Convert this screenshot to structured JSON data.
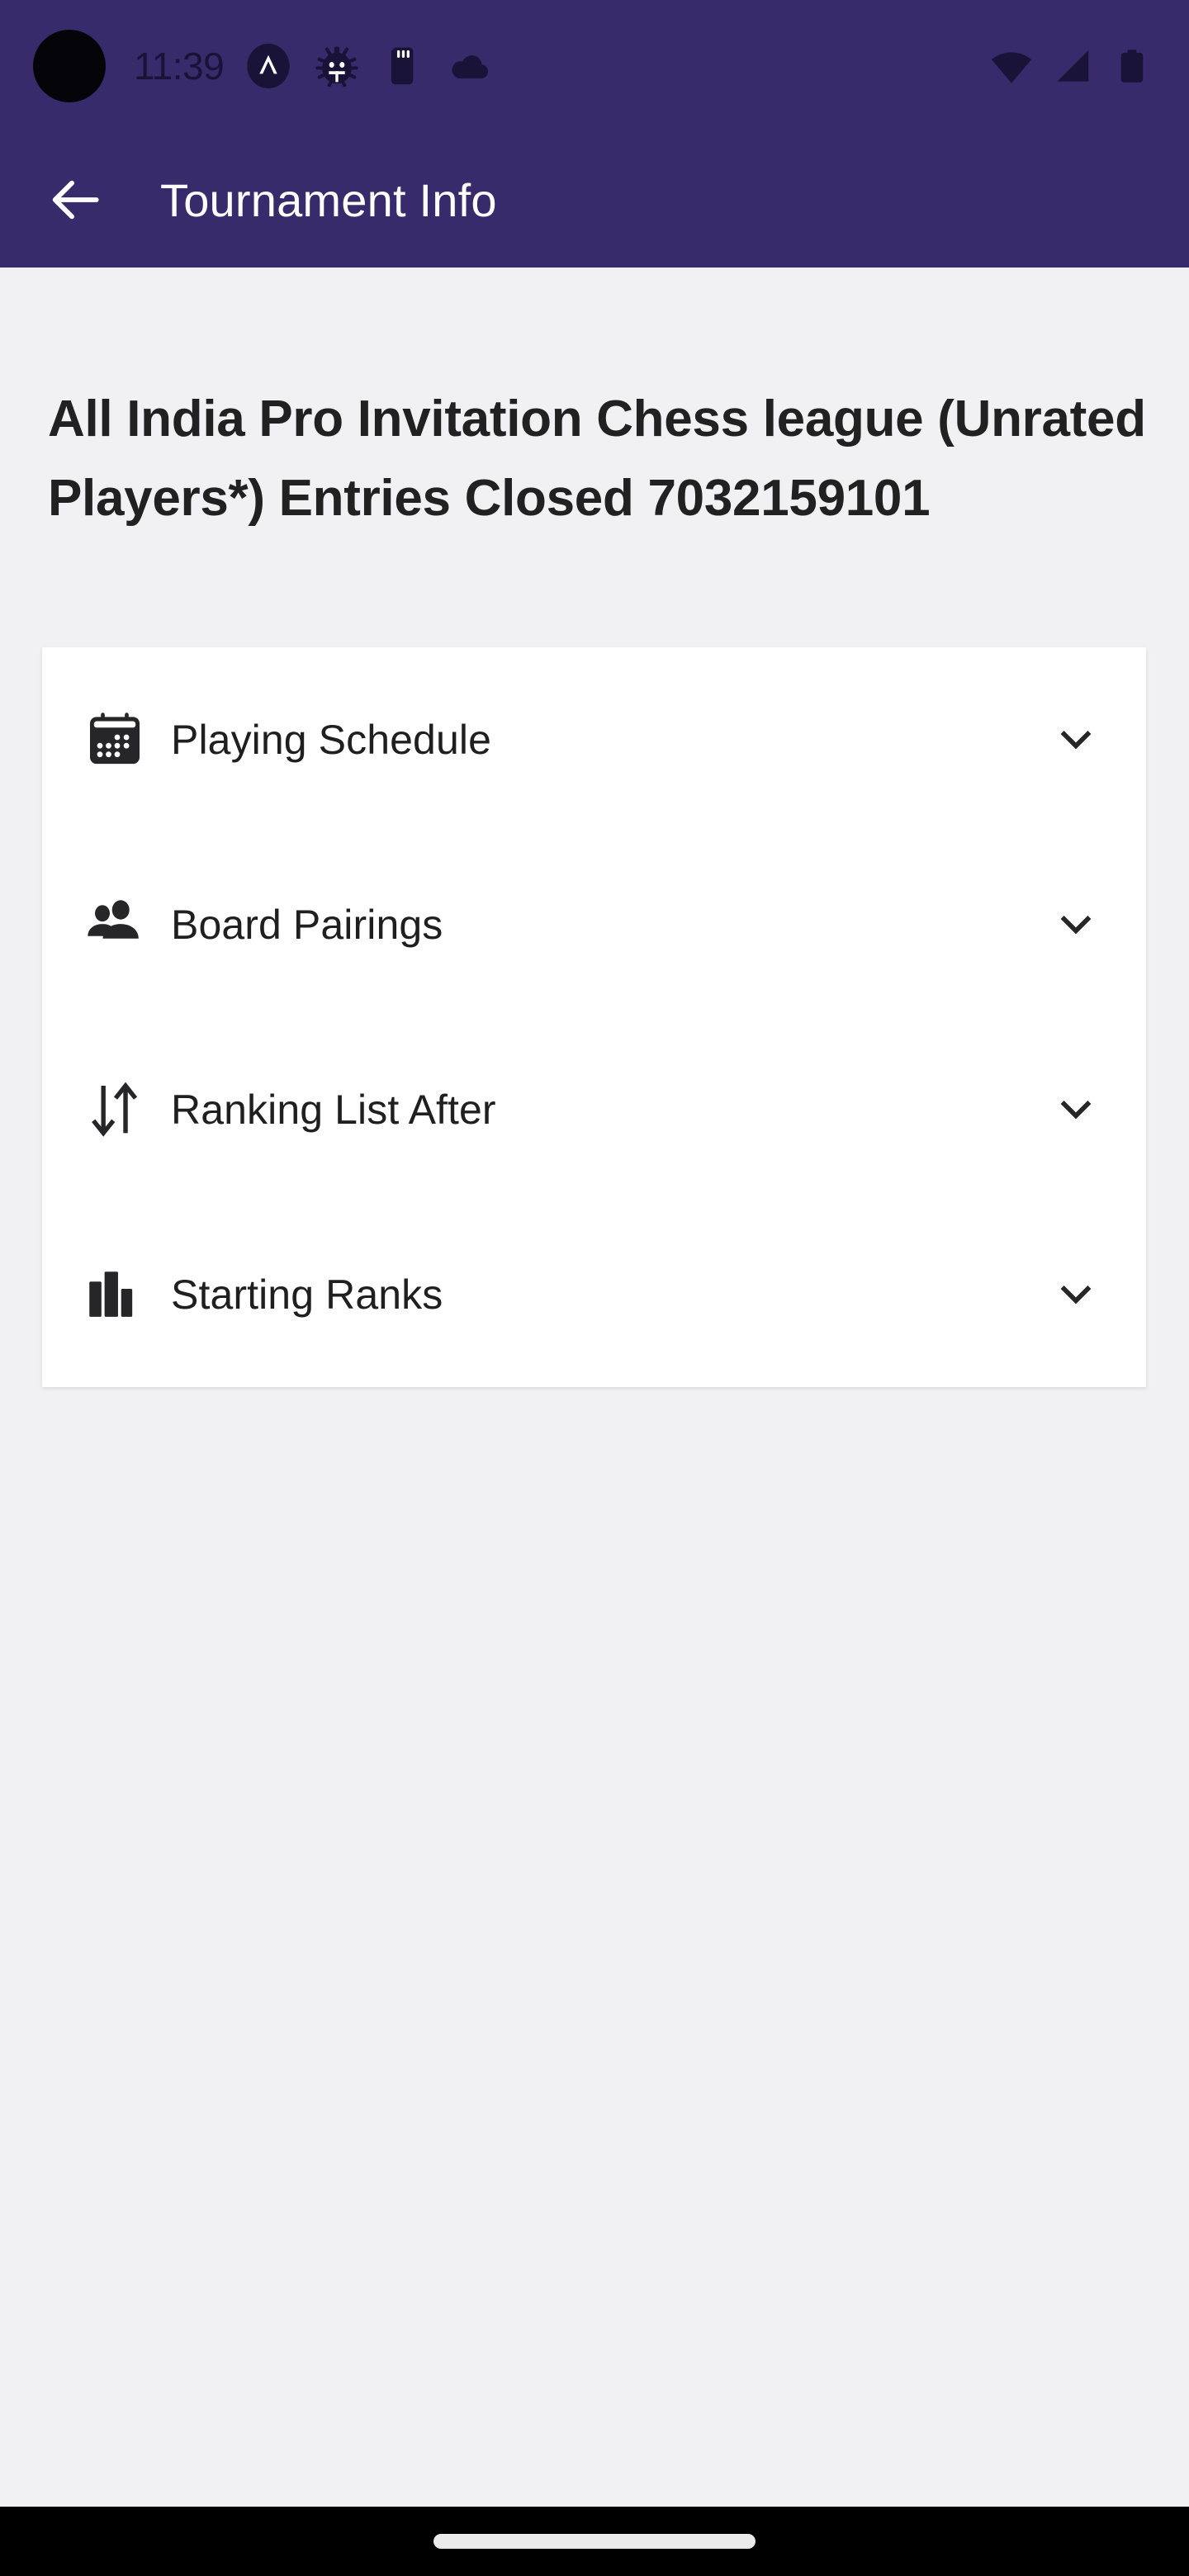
{
  "status_bar": {
    "time": "11:39",
    "left_icons": [
      "camera-punchhole",
      "app-caret-icon",
      "debug-bug-icon",
      "sd-card-icon",
      "cloud-icon"
    ],
    "right_icons": [
      "wifi-icon",
      "cellular-signal-icon",
      "battery-icon"
    ]
  },
  "app_bar": {
    "back_label": "back-arrow-icon",
    "title": "Tournament Info",
    "background_color": "#372B6C",
    "title_color": "#FFFFFF"
  },
  "page": {
    "title": "All India Pro Invitation Chess league (Unrated Players*) Entries Closed 7032159101",
    "background_color": "#F1F1F3"
  },
  "card": {
    "background_color": "#FFFFFF",
    "rows": [
      {
        "label": "Playing Schedule",
        "icon": "calendar-icon",
        "expander": "chevron-down-icon",
        "expanded": false
      },
      {
        "label": "Board Pairings",
        "icon": "people-group-icon",
        "expander": "chevron-down-icon",
        "expanded": false
      },
      {
        "label": "Ranking List After",
        "icon": "sort-arrows-icon",
        "expander": "chevron-down-icon",
        "expanded": false
      },
      {
        "label": "Starting Ranks",
        "icon": "bar-chart-icon",
        "expander": "chevron-down-icon",
        "expanded": false
      }
    ]
  },
  "nav_bar": {
    "home_indicator": "home-gesture-pill",
    "background_color": "#000000"
  }
}
